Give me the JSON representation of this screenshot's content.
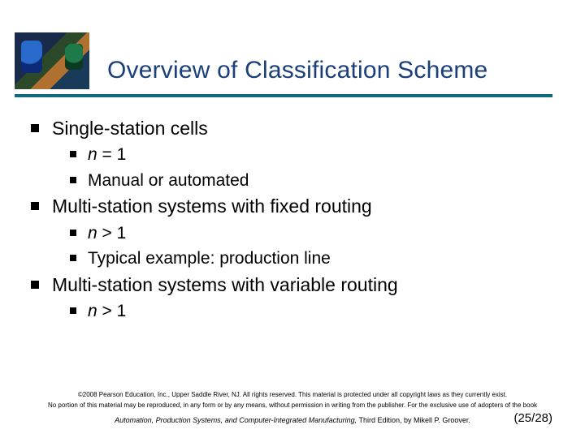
{
  "title": "Overview of Classification Scheme",
  "bullets": {
    "b1": "Single-station cells",
    "b1a_var": "n",
    "b1a_rest": " = 1",
    "b1b": "Manual or automated",
    "b2": "Multi-station systems with fixed routing",
    "b2a_var": "n",
    "b2a_rest": " > 1",
    "b2b": "Typical example: production line",
    "b3": "Multi-station systems with variable routing",
    "b3a_var": "n",
    "b3a_rest": " > 1"
  },
  "footer": {
    "copyright1": "©2008 Pearson Education, Inc., Upper Saddle River, NJ.  All rights reserved.  This material is protected under all copyright laws as they currently exist.",
    "copyright2": "No portion of this material may be reproduced, in any form or by any means, without permission in writing from the publisher.  For the exclusive use of adopters of the book",
    "book_title": "Automation, Production Systems, and Computer-Integrated Manufacturing,",
    "book_rest": " Third Edition, by Mikell P. Groover."
  },
  "page": "(25/28)"
}
